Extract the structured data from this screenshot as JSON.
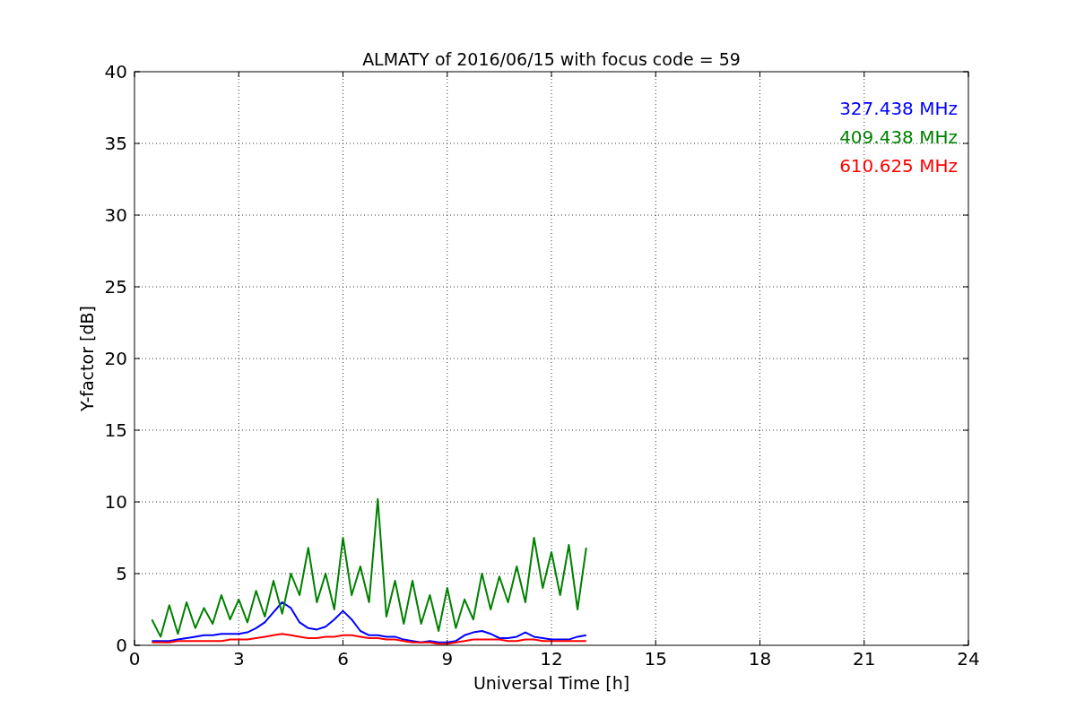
{
  "chart_data": {
    "type": "line",
    "title": "ALMATY of 2016/06/15 with focus code = 59",
    "xlabel": "Universal Time [h]",
    "ylabel": "Y-factor [dB]",
    "xlim": [
      0,
      24
    ],
    "ylim": [
      0,
      40
    ],
    "xticks": [
      0,
      3,
      6,
      9,
      12,
      15,
      18,
      21,
      24
    ],
    "yticks": [
      0,
      5,
      10,
      15,
      20,
      25,
      30,
      35,
      40
    ],
    "grid": true,
    "x": [
      0.5,
      0.75,
      1.0,
      1.25,
      1.5,
      1.75,
      2.0,
      2.25,
      2.5,
      2.75,
      3.0,
      3.25,
      3.5,
      3.75,
      4.0,
      4.25,
      4.5,
      4.75,
      5.0,
      5.25,
      5.5,
      5.75,
      6.0,
      6.25,
      6.5,
      6.75,
      7.0,
      7.25,
      7.5,
      7.75,
      8.0,
      8.25,
      8.5,
      8.75,
      9.0,
      9.25,
      9.5,
      9.75,
      10.0,
      10.25,
      10.5,
      10.75,
      11.0,
      11.25,
      11.5,
      11.75,
      12.0,
      12.25,
      12.5,
      12.75,
      13.0
    ],
    "series": [
      {
        "name": "327.438 MHz",
        "color": "#0000ff",
        "values": [
          0.3,
          0.3,
          0.3,
          0.4,
          0.5,
          0.6,
          0.7,
          0.7,
          0.8,
          0.8,
          0.8,
          0.9,
          1.2,
          1.6,
          2.3,
          3.0,
          2.6,
          1.6,
          1.2,
          1.1,
          1.3,
          1.8,
          2.4,
          1.8,
          1.0,
          0.7,
          0.7,
          0.6,
          0.6,
          0.4,
          0.3,
          0.2,
          0.3,
          0.2,
          0.2,
          0.3,
          0.7,
          0.9,
          1.0,
          0.8,
          0.5,
          0.5,
          0.6,
          0.9,
          0.6,
          0.5,
          0.4,
          0.4,
          0.4,
          0.6,
          0.7
        ]
      },
      {
        "name": "409.438 MHz",
        "color": "#008000",
        "values": [
          1.8,
          0.6,
          2.8,
          0.8,
          3.0,
          1.2,
          2.6,
          1.5,
          3.5,
          1.8,
          3.2,
          1.6,
          3.8,
          2.0,
          4.5,
          2.2,
          5.0,
          3.5,
          6.8,
          3.0,
          5.0,
          2.5,
          7.5,
          3.5,
          5.5,
          3.0,
          10.2,
          2.0,
          4.5,
          1.5,
          4.5,
          1.5,
          3.5,
          1.0,
          4.0,
          1.2,
          3.2,
          1.8,
          5.0,
          2.5,
          4.8,
          3.0,
          5.5,
          3.0,
          7.5,
          4.0,
          6.5,
          3.5,
          7.0,
          2.5,
          6.8
        ]
      },
      {
        "name": "610.625 MHz",
        "color": "#ff0000",
        "values": [
          0.2,
          0.2,
          0.2,
          0.3,
          0.3,
          0.3,
          0.3,
          0.3,
          0.3,
          0.4,
          0.4,
          0.4,
          0.5,
          0.6,
          0.7,
          0.8,
          0.7,
          0.6,
          0.5,
          0.5,
          0.6,
          0.6,
          0.7,
          0.7,
          0.6,
          0.5,
          0.5,
          0.4,
          0.4,
          0.3,
          0.2,
          0.2,
          0.2,
          0.1,
          0.1,
          0.2,
          0.3,
          0.4,
          0.4,
          0.4,
          0.4,
          0.3,
          0.3,
          0.4,
          0.4,
          0.3,
          0.3,
          0.3,
          0.3,
          0.3,
          0.3
        ]
      }
    ]
  }
}
